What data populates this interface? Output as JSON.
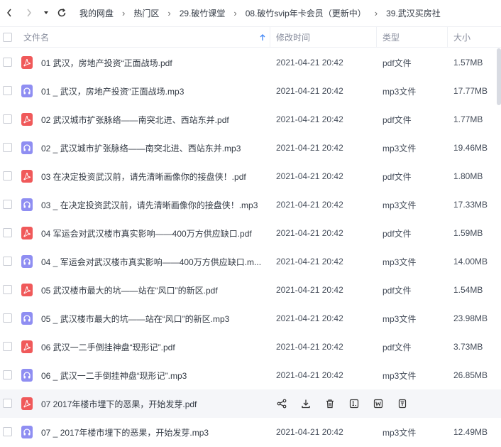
{
  "breadcrumb": [
    "我的网盘",
    "热门区",
    "29.破竹课堂",
    "08.破竹svip年卡会员（更新中）",
    "39.武汉买房社"
  ],
  "columns": {
    "name": "文件名",
    "mtime": "修改时间",
    "type": "类型",
    "size": "大小"
  },
  "files": [
    {
      "icon": "pdf",
      "name": "01  武汉，房地产投资“正面战场.pdf",
      "mtime": "2021-04-21 20:42",
      "type": "pdf文件",
      "size": "1.57MB"
    },
    {
      "icon": "mp3",
      "name": "01 _ 武汉，房地产投资“正面战场.mp3",
      "mtime": "2021-04-21 20:42",
      "type": "mp3文件",
      "size": "17.77MB"
    },
    {
      "icon": "pdf",
      "name": "02  武汉城市扩张脉络——南突北进、西站东并.pdf",
      "mtime": "2021-04-21 20:42",
      "type": "pdf文件",
      "size": "1.77MB"
    },
    {
      "icon": "mp3",
      "name": "02 _ 武汉城市扩张脉络——南突北进、西站东并.mp3",
      "mtime": "2021-04-21 20:42",
      "type": "mp3文件",
      "size": "19.46MB"
    },
    {
      "icon": "pdf",
      "name": "03  在决定投资武汉前，请先清晰画像你的接盘侠！.pdf",
      "mtime": "2021-04-21 20:42",
      "type": "pdf文件",
      "size": "1.80MB"
    },
    {
      "icon": "mp3",
      "name": "03 _ 在决定投资武汉前，请先清晰画像你的接盘侠！.mp3",
      "mtime": "2021-04-21 20:42",
      "type": "mp3文件",
      "size": "17.33MB"
    },
    {
      "icon": "pdf",
      "name": "04  军运会对武汉楼市真实影响——400万方供应缺口.pdf",
      "mtime": "2021-04-21 20:42",
      "type": "pdf文件",
      "size": "1.59MB"
    },
    {
      "icon": "mp3",
      "name": "04 _ 军运会对武汉楼市真实影响——400万方供应缺口.m...",
      "mtime": "2021-04-21 20:42",
      "type": "mp3文件",
      "size": "14.00MB"
    },
    {
      "icon": "pdf",
      "name": "05  武汉楼市最大的坑——站在“风口”的新区.pdf",
      "mtime": "2021-04-21 20:42",
      "type": "pdf文件",
      "size": "1.54MB"
    },
    {
      "icon": "mp3",
      "name": "05 _ 武汉楼市最大的坑——站在“风口”的新区.mp3",
      "mtime": "2021-04-21 20:42",
      "type": "mp3文件",
      "size": "23.98MB"
    },
    {
      "icon": "pdf",
      "name": "06  武汉一二手倒挂神盘“现形记”.pdf",
      "mtime": "2021-04-21 20:42",
      "type": "pdf文件",
      "size": "3.73MB"
    },
    {
      "icon": "mp3",
      "name": "06 _ 武汉一二手倒挂神盘“现形记”.mp3",
      "mtime": "2021-04-21 20:42",
      "type": "mp3文件",
      "size": "26.85MB"
    },
    {
      "icon": "pdf",
      "name": "07  2017年楼市埋下的恶果，开始发芽.pdf",
      "mtime": "",
      "type": "",
      "size": "",
      "hover": true
    },
    {
      "icon": "mp3",
      "name": "07 _ 2017年楼市埋下的恶果，开始发芽.mp3",
      "mtime": "2021-04-21 20:42",
      "type": "mp3文件",
      "size": "12.49MB"
    }
  ],
  "row_actions": [
    "share-icon",
    "download-icon",
    "delete-icon",
    "rename-icon",
    "word-convert-icon",
    "more-doc-icon"
  ]
}
